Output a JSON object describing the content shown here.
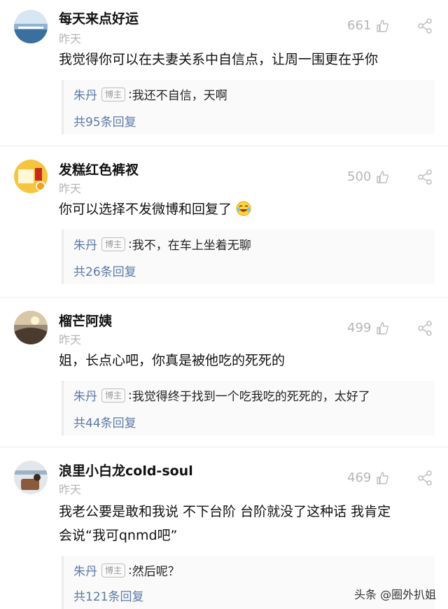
{
  "comments": [
    {
      "username": "每天来点好运",
      "time": "昨天",
      "likes": "661",
      "text": "我觉得你可以在夫妻关系中自信点，让周一围更在乎你",
      "reply": {
        "author": "朱丹",
        "tag": "博主",
        "text": "我还不自信，天啊"
      },
      "total": "共95条回复",
      "avatar_colors": [
        "#cfe0ee",
        "#3a6ea5"
      ]
    },
    {
      "username": "发糕红色裤衩",
      "time": "昨天",
      "likes": "500",
      "text": "你可以选择不发微博和回复了",
      "emoji_icon": "laughing-face-emoji",
      "reply": {
        "author": "朱丹",
        "tag": "博主",
        "text": "我不，在车上坐着无聊"
      },
      "total": "共26条回复",
      "avatar_colors": [
        "#f6c540",
        "#c8291c"
      ]
    },
    {
      "username": "榴芒阿姨",
      "time": "昨天",
      "likes": "499",
      "text": "姐，长点心吧，你真是被他吃的死死的",
      "reply": {
        "author": "朱丹",
        "tag": "博主",
        "text": "我觉得终于找到一个吃我吃的死死的，太好了"
      },
      "total": "共44条回复",
      "avatar_colors": [
        "#c7a57a",
        "#4a3b2e"
      ]
    },
    {
      "username": "浪里小白龙cold-soul",
      "time": "昨天",
      "likes": "469",
      "text_lines": [
        "我老公要是敢和我说 不下台阶 台阶就没了这种话 我肯定",
        "会说“我可qnmd吧”"
      ],
      "reply": {
        "author": "朱丹",
        "tag": "博主",
        "text": "然后呢？"
      },
      "total": "共121条回复",
      "avatar_colors": [
        "#d9dde2",
        "#8b5a3c"
      ]
    }
  ],
  "watermark": "头条 @圈外扒姐",
  "colors": {
    "link": "#5b7aa6",
    "muted": "#b5b5b5",
    "divider": "#ececec"
  }
}
